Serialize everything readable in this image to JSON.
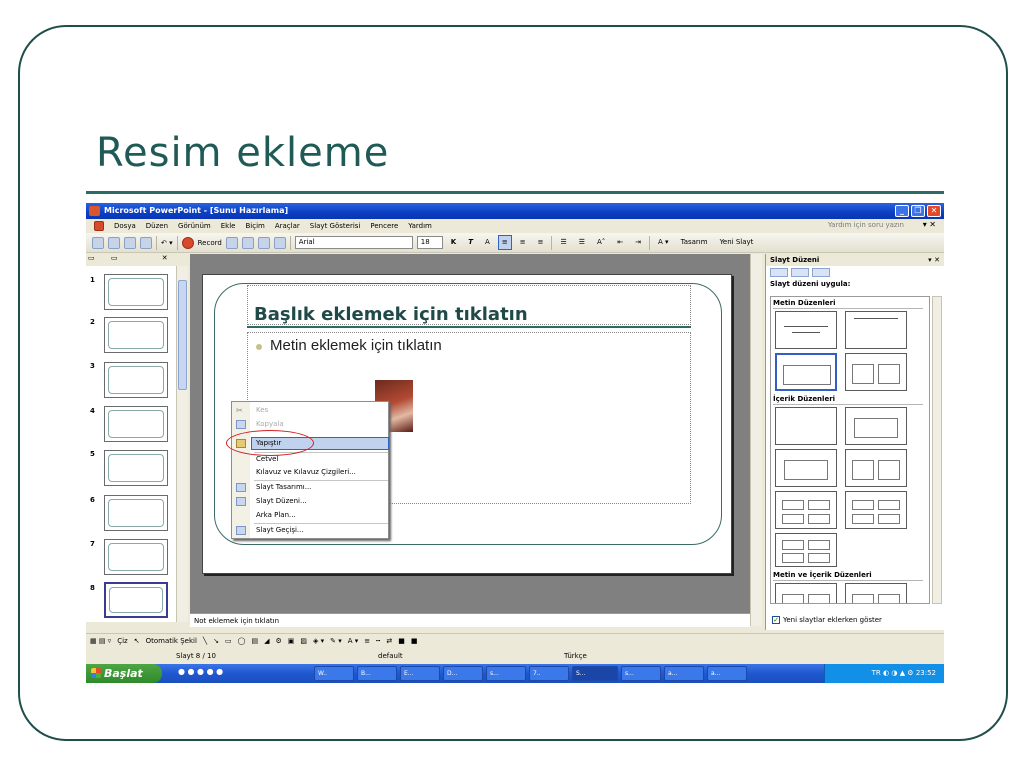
{
  "slide": {
    "title": "Resim ekleme"
  },
  "window": {
    "title": "Microsoft PowerPoint - [Sunu Hazırlama]",
    "controls": [
      "_",
      "❐",
      "✕"
    ]
  },
  "menubar": {
    "items": [
      "Dosya",
      "Düzen",
      "Görünüm",
      "Ekle",
      "Biçim",
      "Araçlar",
      "Slayt Gösterisi",
      "Pencere",
      "Yardım"
    ],
    "help_placeholder": "Yardım için soru yazın"
  },
  "toolbar": {
    "record": "Record",
    "font": "Arial",
    "size": "18",
    "bold": "K",
    "italic": "T",
    "design": "Tasarım",
    "new_slide": "Yeni Slayt"
  },
  "thumbnails": {
    "numbers": [
      "1",
      "2",
      "3",
      "4",
      "5",
      "6",
      "7",
      "8"
    ]
  },
  "editor": {
    "title_placeholder": "Başlık eklemek için tıklatın",
    "body_placeholder": "Metin eklemek için tıklatın",
    "notes_placeholder": "Not eklemek için tıklatın"
  },
  "context_menu": {
    "cut": "Kes",
    "copy": "Kopyala",
    "paste": "Yapıştır",
    "ruler": "Cetvel",
    "guides": "Kılavuz ve Kılavuz Çizgileri...",
    "design": "Slayt Tasarımı...",
    "layout": "Slayt Düzeni...",
    "background": "Arka Plan...",
    "transition": "Slayt Geçişi..."
  },
  "task_pane": {
    "title": "Slayt Düzeni",
    "apply_label": "Slayt düzeni uygula:",
    "sections": [
      "Metin Düzenleri",
      "İçerik Düzenleri",
      "Metin ve İçerik Düzenleri"
    ],
    "show_checkbox": "Yeni slaytlar eklerken göster",
    "show_checked": true
  },
  "drawing_toolbar": {
    "draw": "Çiz",
    "autoshapes": "Otomatik Şekil"
  },
  "status_bar": {
    "slide_count": "Slayt 8 / 10",
    "design": "default",
    "language": "Türkçe"
  },
  "taskbar": {
    "start": "Başlat",
    "buttons": [
      "W..",
      "B...",
      "E...",
      "D...",
      "s...",
      "7..",
      "S...",
      "s...",
      "a...",
      "a..."
    ],
    "tray_lang": "TR",
    "clock": "23:52"
  }
}
